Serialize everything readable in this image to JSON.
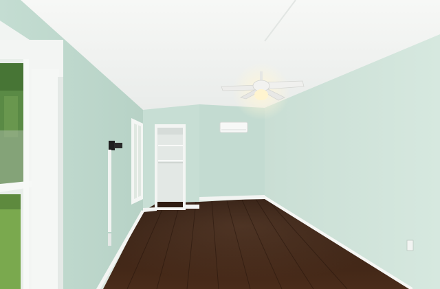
{
  "scene": {
    "kind": "photo",
    "subject": "empty-room-interior",
    "colors": {
      "ceiling": "#f4f5f3",
      "wall_right": "#cfe3da",
      "wall_left": "#bed8cd",
      "wall_back": "#c5ddd3",
      "floor": "#3a2214",
      "trim": "#f6f7f5",
      "fan": "#eeeeec",
      "closet": "#e8ece9",
      "foliage": "#4e7f3a",
      "lawn": "#79a84d"
    },
    "objects": [
      "vaulted-ceiling",
      "ceiling-fan-with-light",
      "mini-split-ac-unit",
      "open-closet-with-shelves",
      "window-left-large",
      "window-left-small",
      "tv-wall-mount-bracket",
      "hardwood-floor",
      "baseboards",
      "electrical-outlet"
    ]
  }
}
